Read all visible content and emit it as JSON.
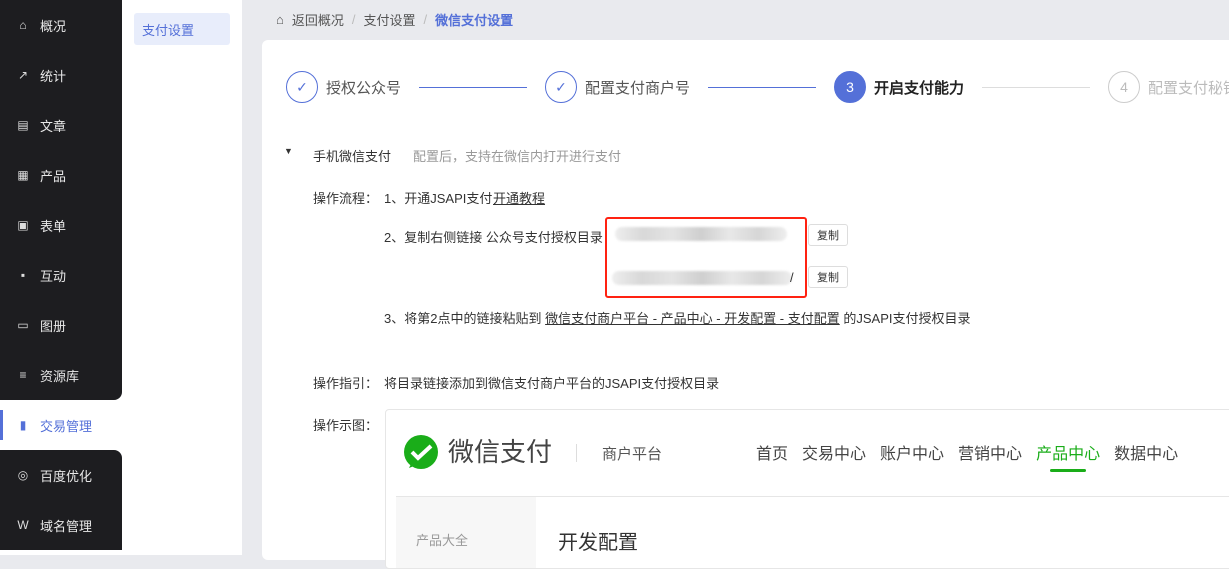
{
  "sidebar": {
    "items": [
      {
        "label": "概况",
        "icon": "home-icon"
      },
      {
        "label": "统计",
        "icon": "chart-icon"
      },
      {
        "label": "文章",
        "icon": "article-icon"
      },
      {
        "label": "产品",
        "icon": "grid-icon"
      },
      {
        "label": "表单",
        "icon": "form-icon"
      },
      {
        "label": "互动",
        "icon": "chat-icon"
      },
      {
        "label": "图册",
        "icon": "gallery-icon"
      },
      {
        "label": "资源库",
        "icon": "database-icon"
      },
      {
        "label": "交易管理",
        "icon": "clipboard-icon",
        "active": true
      },
      {
        "label": "百度优化",
        "icon": "baidu-icon"
      },
      {
        "label": "域名管理",
        "icon": "domain-icon"
      }
    ]
  },
  "submenu": {
    "items": [
      {
        "label": "支付设置"
      }
    ]
  },
  "breadcrumb": {
    "home": "返回概况",
    "parent": "支付设置",
    "current": "微信支付设置"
  },
  "steps": [
    {
      "num": "✓",
      "label": "授权公众号",
      "state": "done"
    },
    {
      "num": "✓",
      "label": "配置支付商户号",
      "state": "done"
    },
    {
      "num": "3",
      "label": "开启支付能力",
      "state": "current"
    },
    {
      "num": "4",
      "label": "配置支付秘钥",
      "state": "todo"
    }
  ],
  "section": {
    "title": "手机微信支付",
    "desc": "配置后，支持在微信内打开进行支付"
  },
  "flow": {
    "label": "操作流程：",
    "step1": "1、开通JSAPI支付",
    "step1_link": "开通教程",
    "step2": "2、复制右侧链接 公众号支付授权目录",
    "url1_suffix": "/",
    "url2_suffix": "/",
    "copy_label": "复制",
    "step3_prefix": "3、将第2点中的链接粘贴到",
    "step3_link": "微信支付商户平台 - 产品中心 - 开发配置 - 支付配置",
    "step3_suffix": "的JSAPI支付授权目录"
  },
  "guide": {
    "label": "操作指引：",
    "text": "将目录链接添加到微信支付商户平台的JSAPI支付授权目录"
  },
  "example": {
    "label": "操作示图：",
    "brand": "微信支付",
    "platform": "商户平台",
    "nav": [
      "首页",
      "交易中心",
      "账户中心",
      "营销中心",
      "产品中心",
      "数据中心"
    ],
    "active_nav": "产品中心",
    "left_item": "产品大全",
    "heading": "开发配置"
  },
  "colors": {
    "accent": "#5470d8",
    "sidebar_bg": "#1d1d20",
    "wechat_green": "#1aad19",
    "highlight": "#ff2211"
  }
}
